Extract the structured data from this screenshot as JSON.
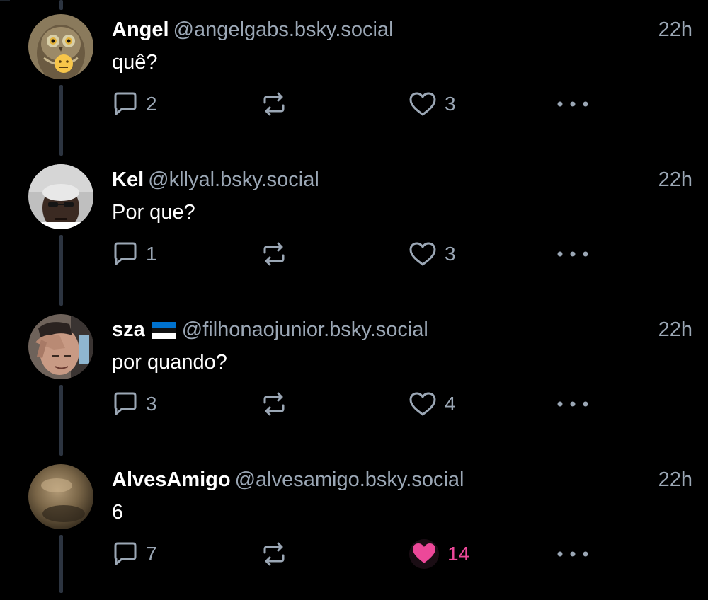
{
  "posts": [
    {
      "author": "Angel",
      "handle": "@angelgabs.bsky.social",
      "time": "22h",
      "text": "quê?",
      "replies": "2",
      "likes": "3",
      "liked": false,
      "avatar": "owl-avatar"
    },
    {
      "author": "Kel",
      "handle": "@kllyal.bsky.social",
      "time": "22h",
      "text": "Por que?",
      "replies": "1",
      "likes": "3",
      "liked": false,
      "avatar": "man-avatar"
    },
    {
      "author": "sza",
      "handle": "@filhonaojunior.bsky.social",
      "time": "22h",
      "text": "por quando?",
      "replies": "3",
      "likes": "4",
      "liked": false,
      "avatar": "facepalm-avatar",
      "flag": "estonia-flag"
    },
    {
      "author": "AlvesAmigo",
      "handle": "@alvesamigo.bsky.social",
      "time": "22h",
      "text": "6",
      "replies": "7",
      "likes": "14",
      "liked": true,
      "avatar": "blurry-avatar"
    }
  ],
  "colors": {
    "background": "#000000",
    "muted": "#9ba7b5",
    "thread_line": "#2c3440",
    "like_active": "#ec4899"
  },
  "icons": [
    "reply-icon",
    "repost-icon",
    "like-icon",
    "more-icon"
  ]
}
